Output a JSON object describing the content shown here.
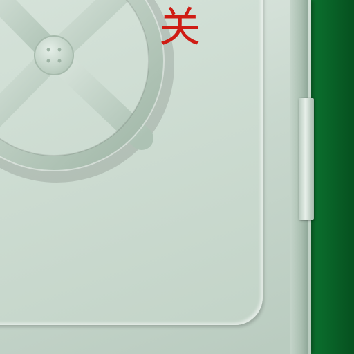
{
  "vault": {
    "status_label": "关",
    "colors": {
      "door": "#c9d8ce",
      "accent_green": "#0a6a2b",
      "label_red": "#cf1c14"
    },
    "icons": {
      "wheel": "vault-wheel-icon",
      "handle": "door-handle-icon"
    }
  }
}
